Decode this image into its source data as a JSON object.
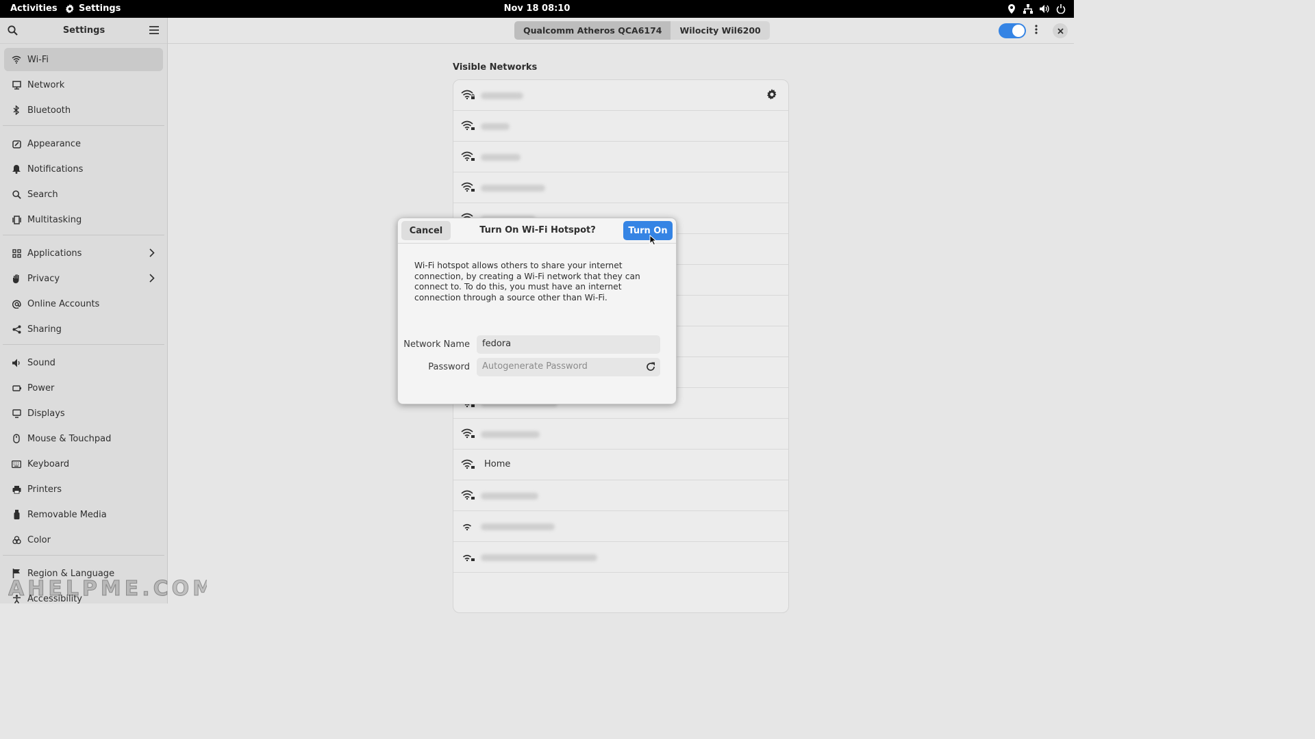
{
  "topbar": {
    "activities": "Activities",
    "app_name": "Settings",
    "clock": "Nov 18  08:10",
    "tray_icons": [
      "location-icon",
      "network-icon",
      "volume-icon",
      "power-icon"
    ]
  },
  "sidebar": {
    "title": "Settings",
    "items": [
      {
        "label": "Wi-Fi",
        "icon": "wifi-icon",
        "selected": true
      },
      {
        "label": "Network",
        "icon": "network-icon"
      },
      {
        "label": "Bluetooth",
        "icon": "bluetooth-icon"
      },
      {
        "label": "Appearance",
        "icon": "appearance-icon"
      },
      {
        "label": "Notifications",
        "icon": "bell-icon"
      },
      {
        "label": "Search",
        "icon": "search-icon"
      },
      {
        "label": "Multitasking",
        "icon": "multitasking-icon"
      },
      {
        "label": "Applications",
        "icon": "apps-icon",
        "chevron": true
      },
      {
        "label": "Privacy",
        "icon": "hand-icon",
        "chevron": true
      },
      {
        "label": "Online Accounts",
        "icon": "at-icon"
      },
      {
        "label": "Sharing",
        "icon": "share-icon"
      },
      {
        "label": "Sound",
        "icon": "speaker-icon"
      },
      {
        "label": "Power",
        "icon": "power-icon"
      },
      {
        "label": "Displays",
        "icon": "display-icon"
      },
      {
        "label": "Mouse & Touchpad",
        "icon": "mouse-icon"
      },
      {
        "label": "Keyboard",
        "icon": "keyboard-icon"
      },
      {
        "label": "Printers",
        "icon": "printer-icon"
      },
      {
        "label": "Removable Media",
        "icon": "usb-icon"
      },
      {
        "label": "Color",
        "icon": "color-icon"
      },
      {
        "label": "Region & Language",
        "icon": "flag-icon"
      },
      {
        "label": "Accessibility",
        "icon": "accessibility-icon"
      }
    ]
  },
  "header": {
    "adapters": [
      "Qualcomm Atheros QCA6174",
      "Wilocity Wil6200"
    ],
    "active_adapter": "Qualcomm Atheros QCA6174",
    "wifi_enabled": true
  },
  "networks": {
    "title": "Visible Networks",
    "known_name": "Home"
  },
  "dialog": {
    "cancel": "Cancel",
    "title": "Turn On Wi-Fi Hotspot?",
    "confirm": "Turn On",
    "description": "Wi-Fi hotspot allows others to share your internet connection, by creating a Wi-Fi network that they can connect to. To do this, you must have an internet connection through a source other than Wi-Fi.",
    "network_name_label": "Network Name",
    "network_name_value": "fedora",
    "password_label": "Password",
    "password_placeholder": "Autogenerate Password"
  },
  "watermark": "AHELPME.COM",
  "colors": {
    "accent": "#3584e4",
    "topbar": "#000000"
  }
}
